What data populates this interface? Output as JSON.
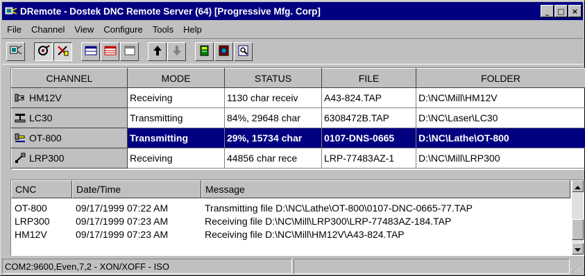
{
  "window": {
    "title": "DRemote - Dostek DNC Remote Server (64) [Progressive Mfg. Corp]",
    "controls": {
      "minimize": "_",
      "maximize": "□",
      "close": "×"
    }
  },
  "menu": [
    "File",
    "Channel",
    "View",
    "Configure",
    "Tools",
    "Help"
  ],
  "toolbar": {
    "buttons": [
      {
        "icon": "channel-icon"
      },
      {
        "icon": "connect-icon",
        "pressed": true
      },
      {
        "icon": "disconnect-icon",
        "pressed": true
      },
      {
        "icon": "window-icon"
      },
      {
        "icon": "window-red-icon"
      },
      {
        "icon": "blank-window-icon"
      },
      {
        "icon": "arrow-up-icon"
      },
      {
        "icon": "arrow-down-icon"
      },
      {
        "icon": "book-icon"
      },
      {
        "icon": "globe-book-icon"
      },
      {
        "icon": "preview-icon"
      }
    ]
  },
  "channels": {
    "columns": [
      "CHANNEL",
      "MODE",
      "STATUS",
      "FILE",
      "FOLDER"
    ],
    "rows": [
      {
        "channel": "HM12V",
        "icon": "mill-icon",
        "mode": "Receiving",
        "status": "1130 char receiv",
        "file": "A43-824.TAP",
        "folder": "D:\\NC\\Mill\\HM12V",
        "selected": false
      },
      {
        "channel": "LC30",
        "icon": "laser-icon",
        "mode": "Transmitting",
        "status": "84%, 29648 char",
        "file": "6308472B.TAP",
        "folder": "D:\\NC\\Laser\\LC30",
        "selected": false
      },
      {
        "channel": "OT-800",
        "icon": "lathe-icon",
        "mode": "Transmitting",
        "status": "29%, 15734 char",
        "file": "0107-DNS-0665",
        "folder": "D:\\NC\\Lathe\\OT-800",
        "selected": true
      },
      {
        "channel": "LRP300",
        "icon": "router-icon",
        "mode": "Receiving",
        "status": "44856 char rece",
        "file": "LRP-77483AZ-1",
        "folder": "D:\\NC\\Mill\\LRP300",
        "selected": false
      }
    ]
  },
  "log": {
    "columns": [
      "CNC",
      "Date/Time",
      "Message"
    ],
    "rows": [
      {
        "cnc": "OT-800",
        "datetime": "09/17/1999 07:22 AM",
        "message": "Transmitting file D:\\NC\\Lathe\\OT-800\\0107-DNC-0665-77.TAP"
      },
      {
        "cnc": "LRP300",
        "datetime": "09/17/1999 07:23 AM",
        "message": "Receiving file D:\\NC\\Mill\\LRP300\\LRP-77483AZ-184.TAP"
      },
      {
        "cnc": "HM12V",
        "datetime": "09/17/1999 07:23 AM",
        "message": "Receiving file D:\\NC\\Mill\\HM12V\\A43-824.TAP"
      }
    ]
  },
  "statusbar": {
    "port": "COM2:9600,Even,7,2 - XON/XOFF - ISO",
    "panel2": ""
  },
  "colors": {
    "titlebar": "#000080",
    "selection": "#000080",
    "face": "#c0c0c0"
  }
}
